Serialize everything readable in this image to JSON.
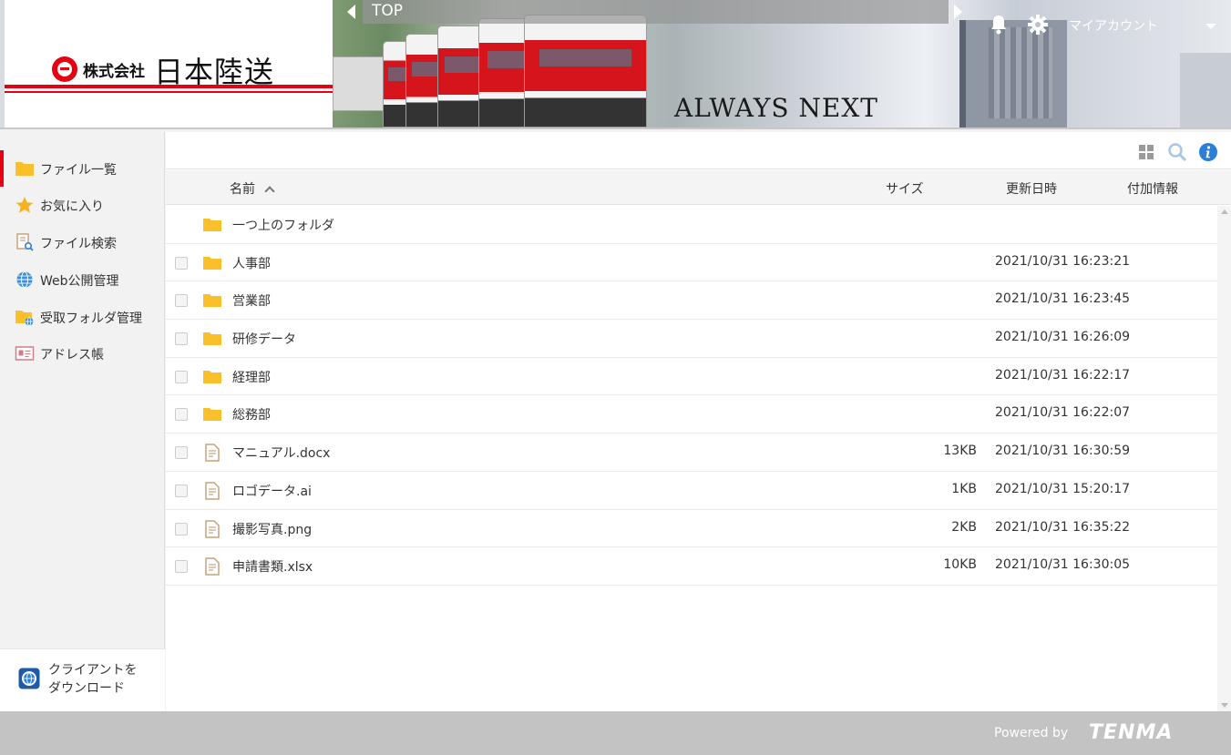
{
  "header": {
    "logo": {
      "prefix": "株式会社",
      "name": "日本陸送"
    },
    "banner": {
      "slogan": "ALWAYS NEXT"
    },
    "path": {
      "label": "TOP"
    },
    "account_label": "マイアカウント"
  },
  "sidebar": {
    "items": [
      {
        "label": "ファイル一覧",
        "icon": "folder-icon",
        "active": true
      },
      {
        "label": "お気に入り",
        "icon": "star-icon",
        "active": false
      },
      {
        "label": "ファイル検索",
        "icon": "file-search-icon",
        "active": false
      },
      {
        "label": "Web公開管理",
        "icon": "globe-icon",
        "active": false
      },
      {
        "label": "受取フォルダ管理",
        "icon": "receive-folder-icon",
        "active": false
      },
      {
        "label": "アドレス帳",
        "icon": "address-card-icon",
        "active": false
      }
    ],
    "client_download": {
      "line1": "クライアントを",
      "line2": "ダウンロード"
    }
  },
  "table": {
    "columns": {
      "name": "名前",
      "size": "サイズ",
      "updated": "更新日時",
      "extra": "付加情報"
    },
    "parent_folder": "一つ上のフォルダ",
    "rows": [
      {
        "type": "folder",
        "name": "人事部",
        "size": "",
        "updated": "2021/10/31 16:23:21"
      },
      {
        "type": "folder",
        "name": "営業部",
        "size": "",
        "updated": "2021/10/31 16:23:45"
      },
      {
        "type": "folder",
        "name": "研修データ",
        "size": "",
        "updated": "2021/10/31 16:26:09"
      },
      {
        "type": "folder",
        "name": "経理部",
        "size": "",
        "updated": "2021/10/31 16:22:17"
      },
      {
        "type": "folder",
        "name": "総務部",
        "size": "",
        "updated": "2021/10/31 16:22:07"
      },
      {
        "type": "file",
        "name": "マニュアル.docx",
        "size": "13KB",
        "updated": "2021/10/31 16:30:59"
      },
      {
        "type": "file",
        "name": "ロゴデータ.ai",
        "size": "1KB",
        "updated": "2021/10/31 15:20:17"
      },
      {
        "type": "file",
        "name": "撮影写真.png",
        "size": "2KB",
        "updated": "2021/10/31 16:35:22"
      },
      {
        "type": "file",
        "name": "申請書類.xlsx",
        "size": "10KB",
        "updated": "2021/10/31 16:30:05"
      }
    ]
  },
  "footer": {
    "powered_by": "Powered by",
    "brand": "TENMA"
  },
  "colors": {
    "accent_red": "#e60012",
    "folder_yellow": "#f9c02c",
    "info_blue": "#2c7fd6"
  }
}
